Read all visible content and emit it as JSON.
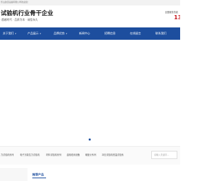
{
  "topbar": {
    "text": "乐山欧迈设备有限公司欢迎您！"
  },
  "header": {
    "brand_name": "试验机行业骨干企业",
    "slogan": "·超越时代 · 品质为本 · 诚信永久",
    "hotline_label": "全国服务热线",
    "hotline_number": "13"
  },
  "nav": {
    "items": [
      {
        "label": "关于我们",
        "dropdown": true
      },
      {
        "label": "产品展示",
        "dropdown": true
      },
      {
        "label": "品牌优势",
        "dropdown": true
      },
      {
        "label": "新闻中心",
        "dropdown": false
      },
      {
        "label": "招聘信息",
        "dropdown": false
      },
      {
        "label": "在线留言",
        "dropdown": false
      },
      {
        "label": "联系我们",
        "dropdown": false
      }
    ],
    "caret": "▾"
  },
  "categories": {
    "items": [
      "力试验机系列",
      "电子万能拉力试验机",
      "材料试验机系列",
      "金相检测设备",
      "硬度计系列",
      "冲击试验机低温试验系"
    ]
  },
  "search": {
    "placeholder": "请输入关键字..."
  },
  "section": {
    "title": "推荐产品"
  },
  "colors": {
    "nav_bg": "#1d4e9e",
    "accent": "#c8161d"
  }
}
